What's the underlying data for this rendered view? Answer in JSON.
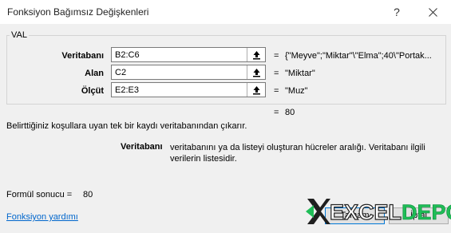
{
  "window": {
    "title": "Fonksiyon Bağımsız Değişkenleri",
    "help_glyph": "?"
  },
  "function_name": "VAL",
  "args": [
    {
      "label": "Veritabanı",
      "value": "B2:C6",
      "result": "{\"Meyve\";\"Miktar\"\\\"Elma\";40\\\"Portak...",
      "eq": "="
    },
    {
      "label": "Alan",
      "value": "C2",
      "result": "\"Miktar\"",
      "eq": "="
    },
    {
      "label": "Ölçüt",
      "value": "E2:E3",
      "result": "\"Muz\"",
      "eq": "="
    }
  ],
  "overall": {
    "eq": "=",
    "value": "80"
  },
  "description": "Belirttiğiniz koşullara uyan tek bir kaydı veritabanından çıkarır.",
  "arg_help": {
    "name": "Veritabanı",
    "text": "veritabanını ya da listeyi oluşturan hücreler aralığı. Veritabanı ilgili verilerin listesidir."
  },
  "formula_result": {
    "label": "Formül sonucu =",
    "value": "80"
  },
  "help_link": "Fonksiyon yardımı",
  "buttons": {
    "ok": "Tamam",
    "cancel": "İptal"
  },
  "logo": {
    "part1": "EXCEL",
    "part2": "DEPO",
    "accent": "#1fbd57"
  },
  "colors": {
    "link": "#0066cc",
    "dialog_bg": "#f0f0f0"
  },
  "icons": {
    "ref_button": "collapse-dialog-arrow-icon"
  }
}
